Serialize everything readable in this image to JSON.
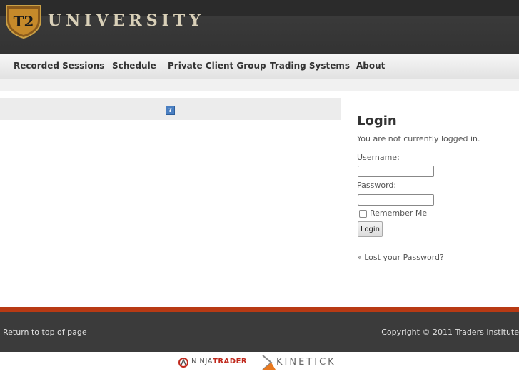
{
  "header": {
    "logo_text": "UNIVERSITY",
    "logo_badge": "T2",
    "brand_color": "#2b2b2b"
  },
  "nav": {
    "items": [
      {
        "label": "Recorded Sessions"
      },
      {
        "label": "Schedule"
      },
      {
        "label": "Private Client Group"
      },
      {
        "label": "Trading Systems"
      },
      {
        "label": "About"
      }
    ]
  },
  "main": {
    "broken_image_glyph": "?"
  },
  "login": {
    "title": "Login",
    "status": "You are not currently logged in.",
    "username_label": "Username:",
    "username_value": "",
    "password_label": "Password:",
    "password_value": "",
    "remember_label": "Remember Me",
    "remember_checked": false,
    "submit_label": "Login",
    "lost_password": "» Lost your Password?"
  },
  "footer": {
    "return_link": "Return to top of page",
    "copyright": "Copyright © 2011 Traders Institute",
    "accent_color": "#b83a14"
  },
  "sponsors": {
    "ninjatrader_a": "NINJA",
    "ninjatrader_b": "TRADER",
    "kinetick": "KINETICK"
  }
}
